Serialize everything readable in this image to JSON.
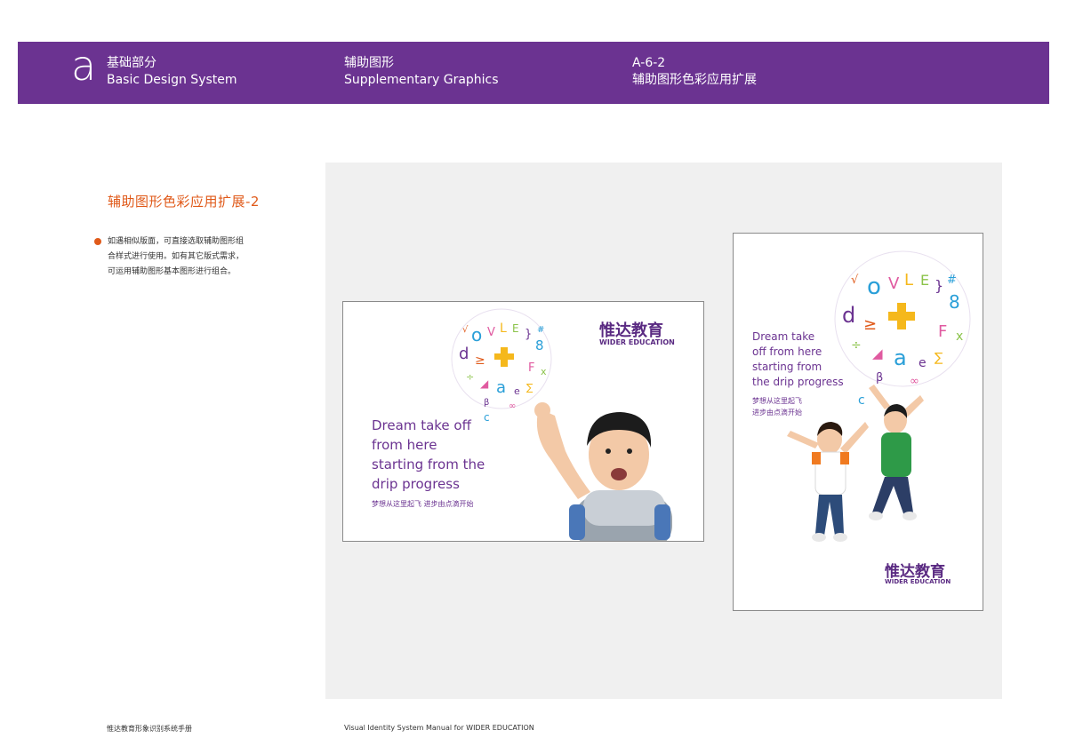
{
  "header": {
    "mark": "a",
    "section_cn": "基础部分",
    "section_en": "Basic Design System",
    "topic_cn": "辅助图形",
    "topic_en": "Supplementary Graphics",
    "code": "A-6-2",
    "code_title": "辅助图形色彩应用扩展"
  },
  "content": {
    "title": "辅助图形色彩应用扩展-2",
    "description": "如遇相似版面，可直接选取辅助图形组合样式进行使用。如有其它版式需求，可运用辅助图形基本图形进行组合。"
  },
  "mockups": {
    "horizontal": {
      "logo_cn": "惟达教育",
      "logo_en": "WIDER EDUCATION",
      "slogan_en": [
        "Dream take off",
        "from here",
        "starting from the",
        "drip progress"
      ],
      "slogan_cn": "梦想从这里起飞  进步由点滴开始"
    },
    "vertical": {
      "logo_cn": "惟达教育",
      "logo_en": "WIDER EDUCATION",
      "slogan_en": [
        "Dream take",
        "off from here",
        "starting from",
        "the drip progress"
      ],
      "slogan_cn": [
        "梦想从这里起飞",
        "进步由点滴开始"
      ]
    }
  },
  "colors": {
    "brand_purple": "#6b3391",
    "accent_orange": "#e05a1a",
    "plus_yellow": "#f5b81c"
  },
  "footer": {
    "left": "惟达教育形象识别系统手册",
    "right": "Visual Identity System Manual for WIDER EDUCATION"
  }
}
